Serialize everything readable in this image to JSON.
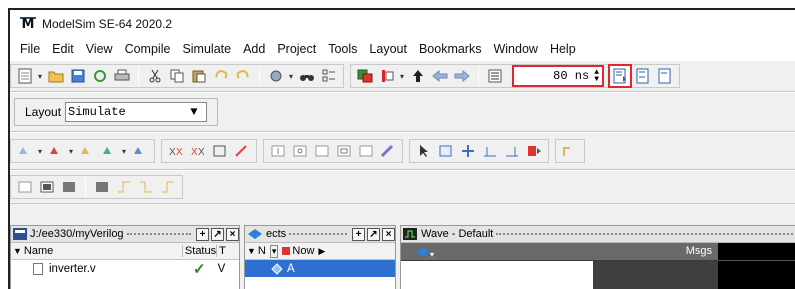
{
  "app": {
    "title": "ModelSim SE-64 2020.2",
    "logo_letter": "M"
  },
  "menu": [
    "File",
    "Edit",
    "View",
    "Compile",
    "Simulate",
    "Add",
    "Project",
    "Tools",
    "Layout",
    "Bookmarks",
    "Window",
    "Help"
  ],
  "toolbar": {
    "run_length": "80 ns",
    "highlighted_controls": [
      "run-length-field",
      "run-button"
    ],
    "accent_color": "#e0262e"
  },
  "layout_bar": {
    "label": "Layout",
    "value": "Simulate"
  },
  "project_pane": {
    "title": "J:/ee330/myVerilog",
    "columns": [
      "Name",
      "Status"
    ],
    "status_col_extra": "T",
    "rows": [
      {
        "name": "inverter.v",
        "status": "✓",
        "type": "V"
      }
    ]
  },
  "objects_pane": {
    "title": "ects",
    "columns": [
      "N",
      "Now"
    ],
    "rows": [
      "A"
    ]
  },
  "wave_pane": {
    "title": "Wave - Default",
    "msgs_label": "Msgs"
  }
}
